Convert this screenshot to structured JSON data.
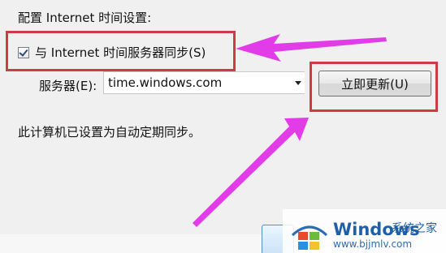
{
  "section": {
    "title": "配置 Internet 时间设置:"
  },
  "sync": {
    "checkbox_label": "与 Internet 时间服务器同步(S)",
    "checked": true
  },
  "server": {
    "label": "服务器(E):",
    "value": "time.windows.com"
  },
  "update_button": {
    "label": "立即更新(U)"
  },
  "status": {
    "text": "此计算机已设置为自动定期同步。"
  },
  "watermark": {
    "name": "Windows",
    "sub": "系统之家",
    "url": "www.bjjmlv.com"
  },
  "colors": {
    "highlight_box": "#cf3b45",
    "arrow": "#e23ce8",
    "watermark_text": "#1f5fa8"
  }
}
